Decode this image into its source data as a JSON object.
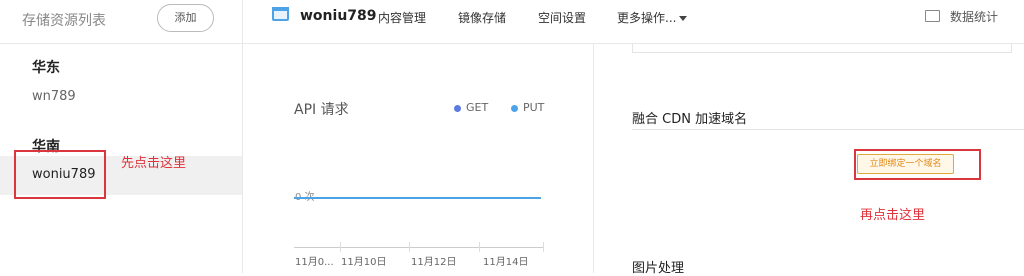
{
  "header": {
    "list_title": "存储资源列表",
    "add_label": "添加",
    "bucket_name": "woniu789",
    "nav": [
      "内容管理",
      "镜像存储",
      "空间设置",
      "更多操作..."
    ],
    "stats_label": "数据统计"
  },
  "sidebar": {
    "regions": [
      {
        "name": "华东",
        "buckets": [
          "wn789"
        ]
      },
      {
        "name": "华南",
        "buckets": [
          "woniu789"
        ]
      }
    ]
  },
  "annotations": {
    "first_click": "先点击这里",
    "second_click": "再点击这里"
  },
  "chart": {
    "title": "API 请求",
    "legend": [
      {
        "name": "GET",
        "color": "#5b7be0"
      },
      {
        "name": "PUT",
        "color": "#4da3e8"
      }
    ],
    "zero_label": "0 次",
    "xticks": [
      "11月0...",
      "11月10日",
      "11月12日",
      "11月14日"
    ]
  },
  "chart_data": {
    "type": "line",
    "title": "API 请求",
    "x": [
      "11月0...",
      "11月10日",
      "11月12日",
      "11月14日"
    ],
    "series": [
      {
        "name": "GET",
        "values": [
          0,
          0,
          0,
          0
        ]
      },
      {
        "name": "PUT",
        "values": [
          0,
          0,
          0,
          0
        ]
      }
    ]
  },
  "right": {
    "cdn_title": "融合 CDN 加速域名",
    "bind_button": "立即绑定一个域名",
    "image_title": "图片处理"
  }
}
